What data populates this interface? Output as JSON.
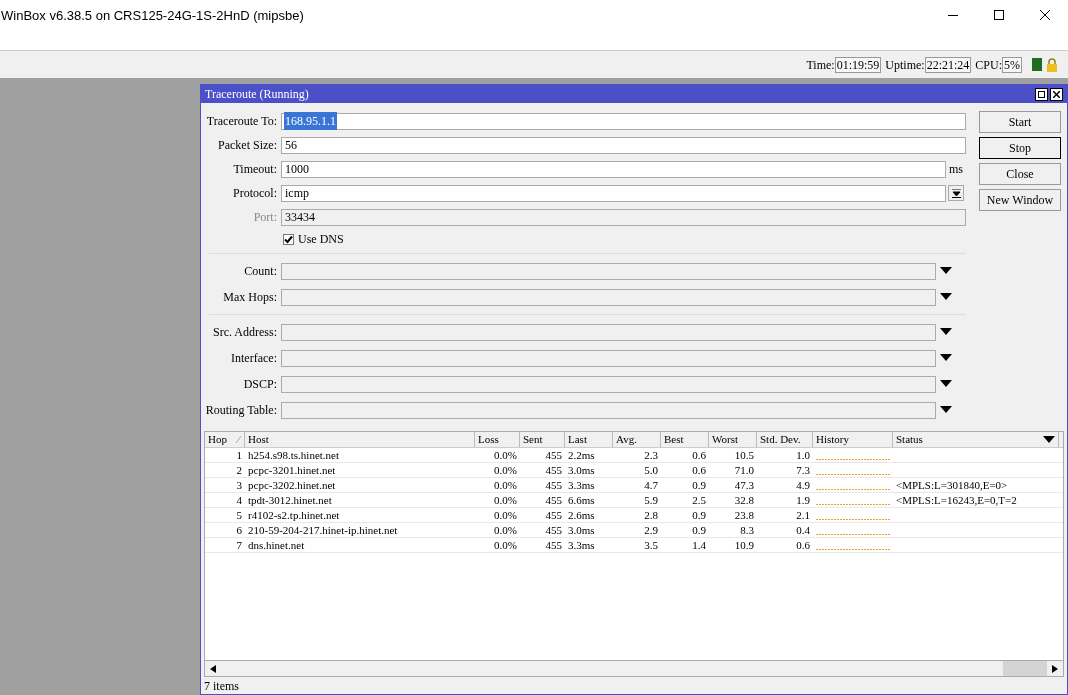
{
  "window": {
    "title": "WinBox v6.38.5 on CRS125-24G-1S-2HnD (mipsbe)"
  },
  "status": {
    "items": [
      {
        "label": "Time:",
        "value": "01:19:59"
      },
      {
        "label": "Uptime:",
        "value": "22:21:24"
      },
      {
        "label": "CPU:",
        "value": "5%"
      }
    ]
  },
  "dialog": {
    "title": "Traceroute (Running)",
    "groups": [
      [
        {
          "label": "Traceroute To:",
          "kind": "text",
          "value": "168.95.1.1",
          "text_selected": true
        },
        {
          "label": "Packet Size:",
          "kind": "text",
          "value": "56",
          "text_selected": false
        },
        {
          "label": "Timeout:",
          "kind": "text",
          "value": "1000",
          "unit": "ms",
          "text_selected": false
        },
        {
          "label": "Protocol:",
          "kind": "select",
          "value": "icmp",
          "text_selected": false
        },
        {
          "label": "Port:",
          "kind": "readonly",
          "value": "33434",
          "disabled": true
        },
        {
          "label": "Use DNS",
          "kind": "checkbox",
          "checked": true
        }
      ],
      [
        {
          "label": "Count:",
          "kind": "combo"
        },
        {
          "label": "Max Hops:",
          "kind": "combo"
        }
      ],
      [
        {
          "label": "Src. Address:",
          "kind": "combo"
        },
        {
          "label": "Interface:",
          "kind": "combo"
        },
        {
          "label": "DSCP:",
          "kind": "combo"
        },
        {
          "label": "Routing Table:",
          "kind": "combo"
        }
      ]
    ],
    "buttons": [
      {
        "label": "Start",
        "focused": false
      },
      {
        "label": "Stop",
        "focused": true
      },
      {
        "label": "Close",
        "focused": false
      },
      {
        "label": "New Window",
        "focused": false
      }
    ]
  },
  "table": {
    "columns": [
      "Hop",
      "Host",
      "Loss",
      "Sent",
      "Last",
      "Avg.",
      "Best",
      "Worst",
      "Std. Dev.",
      "History",
      "Status"
    ],
    "rows": [
      [
        "1",
        "h254.s98.ts.hinet.net",
        "0.0%",
        "455",
        "2.2ms",
        "2.3",
        "0.6",
        "10.5",
        "1.0",
        "",
        ""
      ],
      [
        "2",
        "pcpc-3201.hinet.net",
        "0.0%",
        "455",
        "3.0ms",
        "5.0",
        "0.6",
        "71.0",
        "7.3",
        "",
        ""
      ],
      [
        "3",
        "pcpc-3202.hinet.net",
        "0.0%",
        "455",
        "3.3ms",
        "4.7",
        "0.9",
        "47.3",
        "4.9",
        "",
        "<MPLS:L=301840,E=0>"
      ],
      [
        "4",
        "tpdt-3012.hinet.net",
        "0.0%",
        "455",
        "6.6ms",
        "5.9",
        "2.5",
        "32.8",
        "1.9",
        "",
        "<MPLS:L=16243,E=0,T=2"
      ],
      [
        "5",
        "r4102-s2.tp.hinet.net",
        "0.0%",
        "455",
        "2.6ms",
        "2.8",
        "0.9",
        "23.8",
        "2.1",
        "",
        ""
      ],
      [
        "6",
        "210-59-204-217.hinet-ip.hinet.net",
        "0.0%",
        "455",
        "3.0ms",
        "2.9",
        "0.9",
        "8.3",
        "0.4",
        "",
        ""
      ],
      [
        "7",
        "dns.hinet.net",
        "0.0%",
        "455",
        "3.3ms",
        "3.5",
        "1.4",
        "10.9",
        "0.6",
        "",
        ""
      ]
    ]
  },
  "footer": "7 items"
}
